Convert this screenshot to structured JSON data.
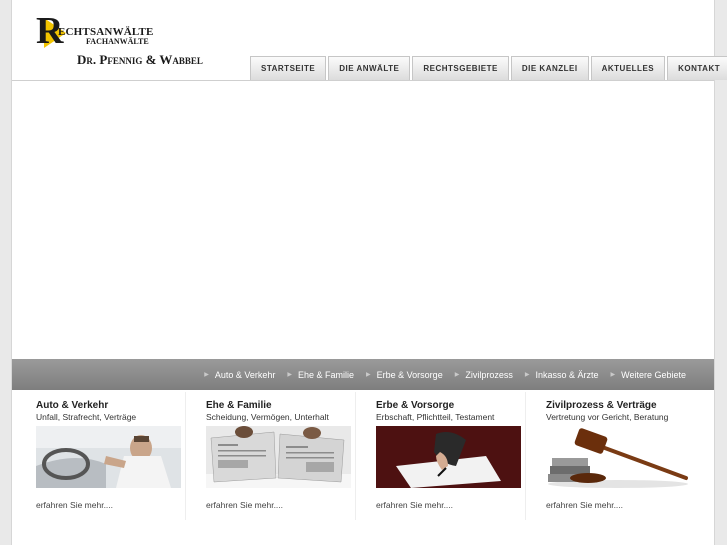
{
  "logo": {
    "letter": "R",
    "line1": "ECHTSANWÄLTE",
    "line2": "FACHANWÄLTE",
    "line3": "Dr. Pfennig & Wabbel"
  },
  "nav": {
    "tabs": [
      "STARTSEITE",
      "DIE ANWÄLTE",
      "RECHTSGEBIETE",
      "DIE KANZLEI",
      "AKTUELLES",
      "KONTAKT"
    ]
  },
  "subnav": {
    "items": [
      "Auto & Verkehr",
      "Ehe & Familie",
      "Erbe & Vorsorge",
      "Zivilprozess",
      "Inkasso & Ärzte",
      "Weitere Gebiete"
    ]
  },
  "columns": [
    {
      "title": "Auto & Verkehr",
      "subtitle": "Unfall, Strafrecht, Verträge",
      "more": "erfahren Sie mehr....",
      "image": "driver-photo"
    },
    {
      "title": "Ehe & Familie",
      "subtitle": "Scheidung, Vermögen, Unterhalt",
      "more": "erfahren Sie mehr....",
      "image": "couple-newspaper-photo"
    },
    {
      "title": "Erbe & Vorsorge",
      "subtitle": "Erbschaft, Pflichtteil, Testament",
      "more": "erfahren Sie mehr....",
      "image": "signing-document-photo"
    },
    {
      "title": "Zivilprozess & Verträge",
      "subtitle": "Vertretung vor Gericht, Beratung",
      "more": "erfahren Sie mehr....",
      "image": "gavel-photo"
    }
  ],
  "colors": {
    "accent": "#f2c400",
    "bar": "#8a8a8a"
  }
}
